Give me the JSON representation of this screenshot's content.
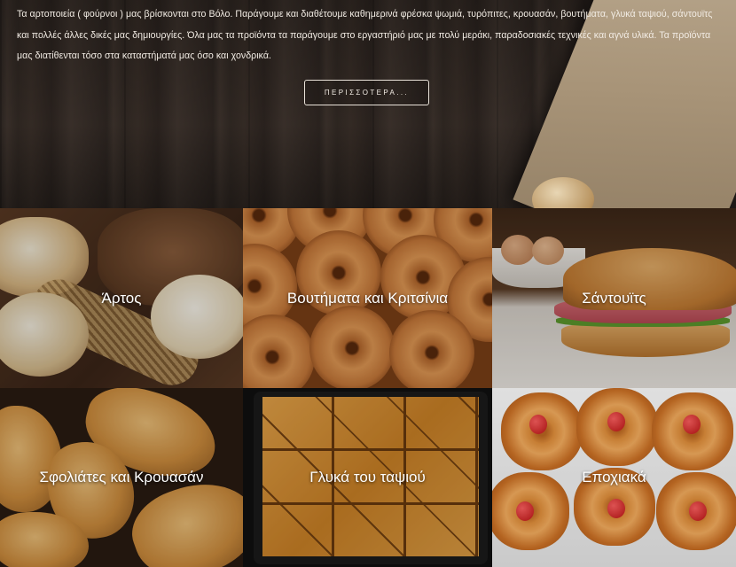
{
  "intro": {
    "text": "Τα αρτοποιεία ( φούρνοι ) μας βρίσκονται στο Βόλο. Παράγουμε και διαθέτουμε καθημερινά φρέσκα ψωμιά, τυρόπιτες, κρουασάν, βουτήματα, γλυκά ταψιού, σάντουϊτς και πολλές άλλες δικές μας δημιουργίες. Όλα μας τα προϊόντα τα παράγουμε στο εργαστήριό μας με πολύ μεράκι, παραδοσιακές τεχνικές και αγνά υλικά. Τα προϊόντα μας διατίθενται τόσο στα καταστήματά μας όσο και χονδρικά.",
    "more_label": "ΠΕΡΙΣΣΟΤΕΡΑ..."
  },
  "categories": [
    {
      "label": "Άρτος"
    },
    {
      "label": "Βουτήματα και Κριτσίνια"
    },
    {
      "label": "Σάντουϊτς"
    },
    {
      "label": "Σφολιάτες και Κρουασάν"
    },
    {
      "label": "Γλυκά του ταψιού"
    },
    {
      "label": "Εποχιακά"
    }
  ],
  "colors": {
    "hero_wood": "#2f2722",
    "button_border": "#e9e2d9",
    "text_light": "#f2ece4"
  }
}
